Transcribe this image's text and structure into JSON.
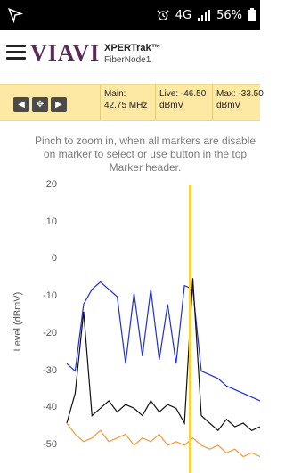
{
  "status": {
    "battery": "56%",
    "network": "4G",
    "left_icon": "navigation-arrow-icon",
    "alarm_icon": "alarm-icon",
    "signal_icon": "signal-icon",
    "battery_icon": "battery-icon"
  },
  "appbar": {
    "brand": "VIAVI",
    "title": "XPERTrak™",
    "subtitle": "FiberNode1",
    "menu_icon": "menu-icon"
  },
  "markers": {
    "main": "Main: 42.75 MHz",
    "live": "Live: -46.50 dBmV",
    "max": "Max: -33.50 dBmV",
    "nav": [
      "left-arrow-icon",
      "move-icon",
      "right-arrow-icon"
    ]
  },
  "hint": {
    "line1": "Pinch to zoom in, when all markers are disable",
    "line2": "on marker to select or use button in the top",
    "line3": "Marker header."
  },
  "chart_data": {
    "type": "line",
    "title": "",
    "xlabel": "",
    "ylabel": "Level (dBmV)",
    "ylim": [
      -55,
      20
    ],
    "yticks": [
      20,
      10,
      0,
      -10,
      -20,
      -30,
      -40,
      -50
    ],
    "series": [
      {
        "color": "#1f2fd6",
        "values": [
          -28,
          -30,
          -12,
          -8,
          -6,
          -8,
          -10,
          -28,
          -9,
          -26,
          -8,
          -27,
          -12,
          -28,
          -7,
          -8,
          -30,
          -31,
          -32,
          -34,
          -35,
          -36,
          -37,
          -38
        ]
      },
      {
        "color": "#111111",
        "values": [
          -44,
          -36,
          -14,
          -42,
          -40,
          -38,
          -41,
          -39,
          -40,
          -42,
          -38,
          -41,
          -39,
          -40,
          -44,
          -5,
          -42,
          -44,
          -46,
          -43,
          -45,
          -44,
          -46,
          -45
        ]
      },
      {
        "color": "#f39a3a",
        "values": [
          -44,
          -47,
          -49,
          -48,
          -46,
          -49,
          -48,
          -47,
          -50,
          -48,
          -49,
          -47,
          -50,
          -49,
          -50,
          -48,
          -50,
          -51,
          -50,
          -52,
          -51,
          -53,
          -52,
          -53
        ]
      }
    ],
    "marker_x_fraction": 0.73,
    "grid": false,
    "colors": {
      "marker": "#f9d23e"
    }
  }
}
